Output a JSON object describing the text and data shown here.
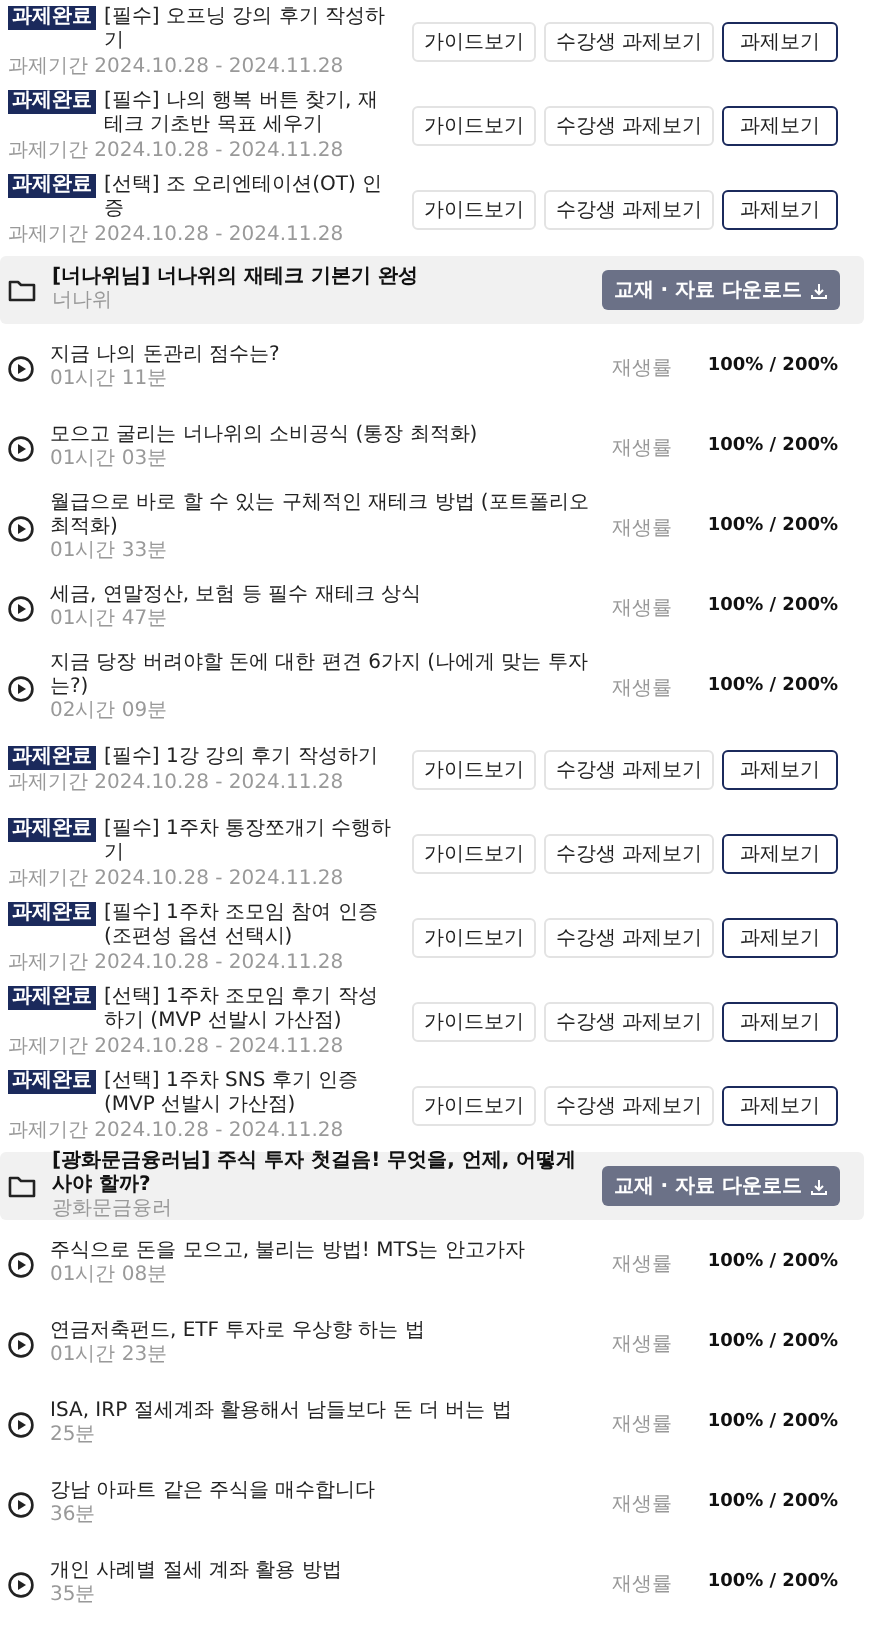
{
  "items": [
    {
      "kind": "assignment",
      "badge": "과제완료",
      "title": "[필수] 오프닝 강의 후기 작성하기",
      "period": "과제기간 2024.10.28 - 2024.11.28",
      "buttons": [
        {
          "label": "가이드보기",
          "emphasized": false
        },
        {
          "label": "수강생 과제보기",
          "emphasized": false
        },
        {
          "label": "과제보기",
          "emphasized": true
        }
      ]
    },
    {
      "kind": "assignment",
      "badge": "과제완료",
      "title": "[필수] 나의 행복 버튼 찾기, 재테크 기초반 목표 세우기",
      "period": "과제기간 2024.10.28 - 2024.11.28",
      "buttons": [
        {
          "label": "가이드보기",
          "emphasized": false
        },
        {
          "label": "수강생 과제보기",
          "emphasized": false
        },
        {
          "label": "과제보기",
          "emphasized": true
        }
      ]
    },
    {
      "kind": "assignment",
      "badge": "과제완료",
      "title": "[선택] 조 오리엔테이션(OT) 인증",
      "period": "과제기간 2024.10.28 - 2024.11.28",
      "buttons": [
        {
          "label": "가이드보기",
          "emphasized": false
        },
        {
          "label": "수강생 과제보기",
          "emphasized": false
        },
        {
          "label": "과제보기",
          "emphasized": true
        }
      ]
    },
    {
      "kind": "folder",
      "title": "[너나위님] 너나위의 재테크 기본기 완성",
      "subtitle": "너나위",
      "button": "교재 · 자료 다운로드"
    },
    {
      "kind": "lecture",
      "title": "지금 나의 돈관리 점수는?",
      "duration": "01시간 11분",
      "rate_label": "재생률",
      "rate": "100% / 200%"
    },
    {
      "kind": "lecture",
      "title": "모으고 굴리는 너나위의 소비공식 (통장 최적화)",
      "duration": "01시간 03분",
      "rate_label": "재생률",
      "rate": "100% / 200%"
    },
    {
      "kind": "lecture",
      "title": "월급으로 바로 할 수 있는 구체적인 재테크 방법 (포트폴리오 최적화)",
      "duration": "01시간 33분",
      "rate_label": "재생률",
      "rate": "100% / 200%"
    },
    {
      "kind": "lecture",
      "title": "세금, 연말정산, 보험 등 필수 재테크 상식",
      "duration": "01시간 47분",
      "rate_label": "재생률",
      "rate": "100% / 200%"
    },
    {
      "kind": "lecture",
      "title": "지금 당장 버려야할 돈에 대한 편견 6가지 (나에게 맞는 투자는?)",
      "duration": "02시간 09분",
      "rate_label": "재생률",
      "rate": "100% / 200%"
    },
    {
      "kind": "assignment",
      "badge": "과제완료",
      "title": "[필수] 1강 강의 후기 작성하기",
      "period": "과제기간 2024.10.28 - 2024.11.28",
      "buttons": [
        {
          "label": "가이드보기",
          "emphasized": false
        },
        {
          "label": "수강생 과제보기",
          "emphasized": false
        },
        {
          "label": "과제보기",
          "emphasized": true
        }
      ]
    },
    {
      "kind": "assignment",
      "badge": "과제완료",
      "title": "[필수] 1주차 통장쪼개기 수행하기",
      "period": "과제기간 2024.10.28 - 2024.11.28",
      "buttons": [
        {
          "label": "가이드보기",
          "emphasized": false
        },
        {
          "label": "수강생 과제보기",
          "emphasized": false
        },
        {
          "label": "과제보기",
          "emphasized": true
        }
      ]
    },
    {
      "kind": "assignment",
      "badge": "과제완료",
      "title": "[필수] 1주차 조모임 참여 인증 (조편성 옵션 선택시)",
      "period": "과제기간 2024.10.28 - 2024.11.28",
      "buttons": [
        {
          "label": "가이드보기",
          "emphasized": false
        },
        {
          "label": "수강생 과제보기",
          "emphasized": false
        },
        {
          "label": "과제보기",
          "emphasized": true
        }
      ]
    },
    {
      "kind": "assignment",
      "badge": "과제완료",
      "title": "[선택] 1주차 조모임 후기 작성하기 (MVP 선발시 가산점)",
      "period": "과제기간 2024.10.28 - 2024.11.28",
      "buttons": [
        {
          "label": "가이드보기",
          "emphasized": false
        },
        {
          "label": "수강생 과제보기",
          "emphasized": false
        },
        {
          "label": "과제보기",
          "emphasized": true
        }
      ]
    },
    {
      "kind": "assignment",
      "badge": "과제완료",
      "title": "[선택] 1주차 SNS 후기 인증 (MVP 선발시 가산점)",
      "period": "과제기간 2024.10.28 - 2024.11.28",
      "buttons": [
        {
          "label": "가이드보기",
          "emphasized": false
        },
        {
          "label": "수강생 과제보기",
          "emphasized": false
        },
        {
          "label": "과제보기",
          "emphasized": true
        }
      ]
    },
    {
      "kind": "folder",
      "title": "[광화문금융러님] 주식 투자 첫걸음! 무엇을, 언제, 어떻게 사야 할까?",
      "subtitle": "광화문금융러",
      "button": "교재 · 자료 다운로드"
    },
    {
      "kind": "lecture",
      "title": "주식으로 돈을 모으고, 불리는 방법! MTS는 안고가자",
      "duration": "01시간 08분",
      "rate_label": "재생률",
      "rate": "100% / 200%"
    },
    {
      "kind": "lecture",
      "title": "연금저축펀드, ETF 투자로 우상향 하는 법",
      "duration": "01시간 23분",
      "rate_label": "재생률",
      "rate": "100% / 200%"
    },
    {
      "kind": "lecture",
      "title": "ISA, IRP 절세계좌 활용해서 남들보다 돈 더 버는 법",
      "duration": "25분",
      "rate_label": "재생률",
      "rate": "100% / 200%"
    },
    {
      "kind": "lecture",
      "title": "강남 아파트 같은 주식을 매수합니다",
      "duration": "36분",
      "rate_label": "재생률",
      "rate": "100% / 200%"
    },
    {
      "kind": "lecture",
      "title": "개인 사례별 절세 계좌 활용 방법",
      "duration": "35분",
      "rate_label": "재생률",
      "rate": "100% / 200%"
    }
  ]
}
